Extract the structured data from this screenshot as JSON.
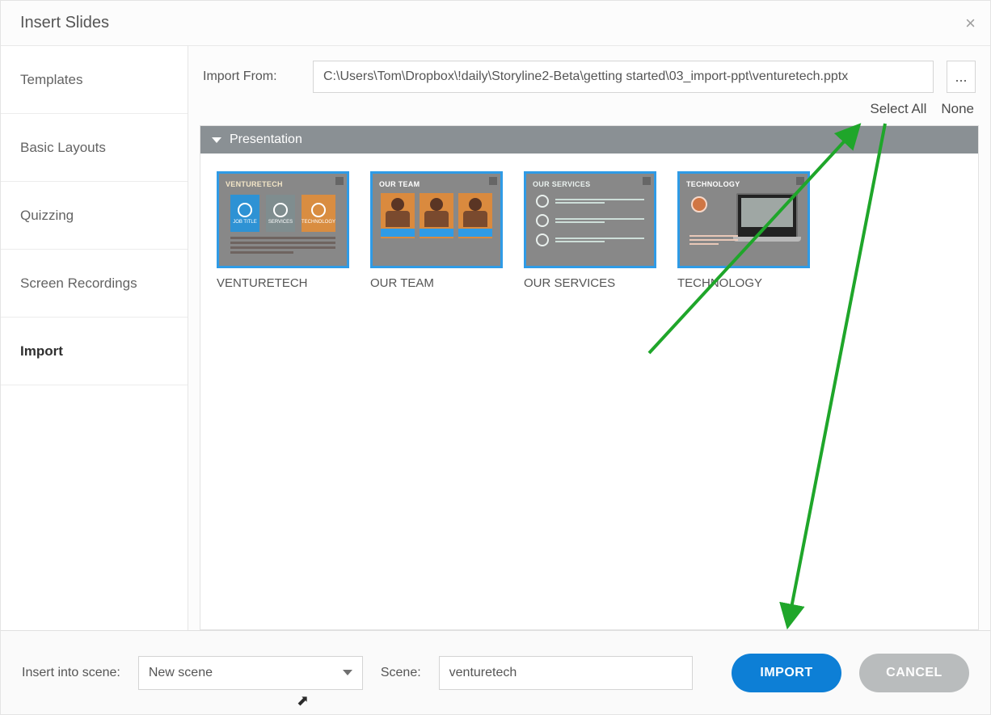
{
  "dialog": {
    "title": "Insert Slides"
  },
  "sidebar": {
    "items": [
      {
        "label": "Templates"
      },
      {
        "label": "Basic Layouts"
      },
      {
        "label": "Quizzing"
      },
      {
        "label": "Screen Recordings"
      },
      {
        "label": "Import"
      }
    ],
    "active_index": 4
  },
  "import": {
    "label": "Import From:",
    "path": "C:\\Users\\Tom\\Dropbox\\!daily\\Storyline2-Beta\\getting started\\03_import-ppt\\venturetech.pptx",
    "browse_glyph": "..."
  },
  "selection": {
    "select_all": "Select All",
    "none": "None"
  },
  "panel": {
    "header": "Presentation",
    "slides": [
      {
        "caption": "VENTURETECH",
        "strip": "VENTURETECH",
        "kind": "s1",
        "mini_labels": [
          "JOB TITLE",
          "SERVICES",
          "TECHNOLOGY"
        ]
      },
      {
        "caption": "OUR TEAM",
        "strip": "OUR TEAM",
        "kind": "s2"
      },
      {
        "caption": "OUR SERVICES",
        "strip": "OUR SERVICES",
        "kind": "s3"
      },
      {
        "caption": "TECHNOLOGY",
        "strip": "TECHNOLOGY",
        "kind": "s4"
      }
    ]
  },
  "footer": {
    "insert_label": "Insert into scene:",
    "scene_dropdown_value": "New scene",
    "scene_label": "Scene:",
    "scene_value": "venturetech",
    "import_btn": "IMPORT",
    "cancel_btn": "CANCEL"
  },
  "colors": {
    "accent": "#0d7fd6",
    "annotation": "#1fa62a"
  }
}
